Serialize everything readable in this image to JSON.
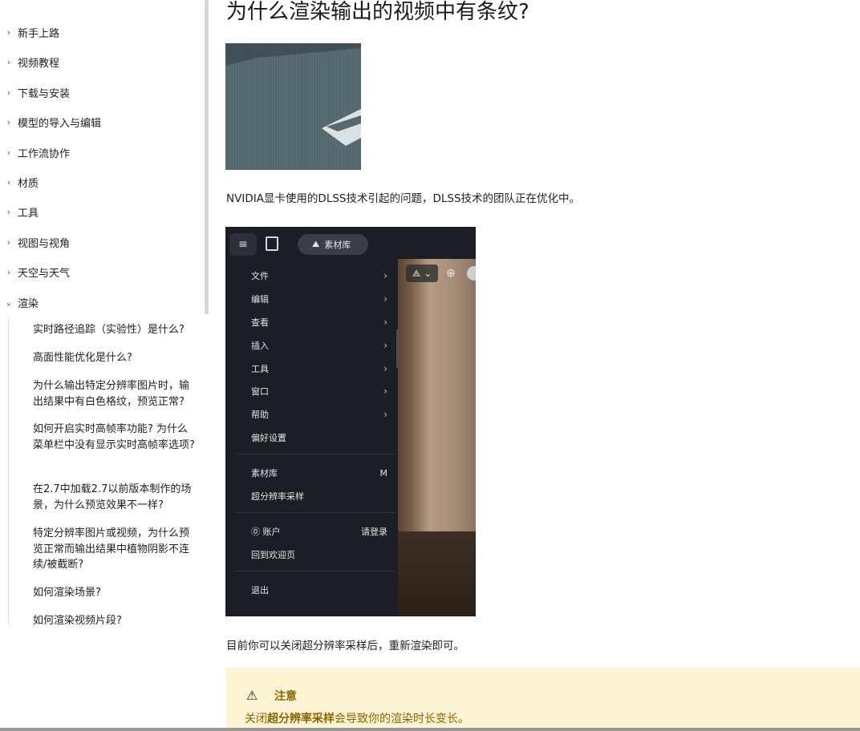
{
  "sidebar": {
    "items": [
      {
        "label": "新手上路",
        "chevron": "›"
      },
      {
        "label": "视频教程",
        "chevron": "›"
      },
      {
        "label": "下载与安装",
        "chevron": "›"
      },
      {
        "label": "模型的导入与编辑",
        "chevron": "›"
      },
      {
        "label": "工作流协作",
        "chevron": "›"
      },
      {
        "label": "材质",
        "chevron": "›"
      },
      {
        "label": "工具",
        "chevron": "›"
      },
      {
        "label": "视图与视角",
        "chevron": "›"
      },
      {
        "label": "天空与天气",
        "chevron": "›"
      },
      {
        "label": "渲染",
        "chevron": "⌄"
      }
    ],
    "sub_items": [
      "实时路径追踪（实验性）是什么?",
      "高面性能优化是什么?",
      "为什么输出特定分辨率图片时，输出结果中有白色格纹，预览正常?",
      "如何开启实时高帧率功能? 为什么菜单栏中没有显示实时高帧率选项?",
      "在2.7中加载2.7以前版本制作的场景，为什么预览效果不一样?",
      "特定分辨率图片或视频，为什么预览正常而输出结果中植物阴影不连续/被截断?",
      "如何渲染场景?",
      "如何渲染视频片段?"
    ]
  },
  "main": {
    "title": "为什么渲染输出的视频中有条纹?",
    "para1": "NVIDIA显卡使用的DLSS技术引起的问题，DLSS技术的团队正在优化中。",
    "para2": "目前你可以关闭超分辨率采样后，重新渲染即可。"
  },
  "screenshot": {
    "burger_icon": "≡",
    "library_pill": "素材库",
    "library_icon": "⛰",
    "viewport_ctrl": "⟁ ⌄",
    "globe_icon": "⊕",
    "menu": {
      "group1": [
        {
          "label": "文件",
          "arrow": "›"
        },
        {
          "label": "编辑",
          "arrow": "›"
        },
        {
          "label": "查看",
          "arrow": "›"
        },
        {
          "label": "插入",
          "arrow": "›"
        },
        {
          "label": "工具",
          "arrow": "›"
        },
        {
          "label": "窗口",
          "arrow": "›"
        },
        {
          "label": "帮助",
          "arrow": "›"
        },
        {
          "label": "偏好设置",
          "arrow": ""
        }
      ],
      "group2": [
        {
          "label": "素材库",
          "shortcut": "M"
        },
        {
          "label": "超分辨率采样",
          "shortcut": ""
        }
      ],
      "group3": [
        {
          "label": "⓪ 账户",
          "shortcut": "请登录"
        },
        {
          "label": "回到欢迎页",
          "shortcut": ""
        }
      ],
      "group4": [
        {
          "label": "退出",
          "shortcut": ""
        }
      ]
    }
  },
  "callout": {
    "icon": "⚠",
    "title": "注意",
    "text_pre": "关闭",
    "text_bold": "超分辨率采样",
    "text_post": "会导致你的渲染时长变长。"
  }
}
